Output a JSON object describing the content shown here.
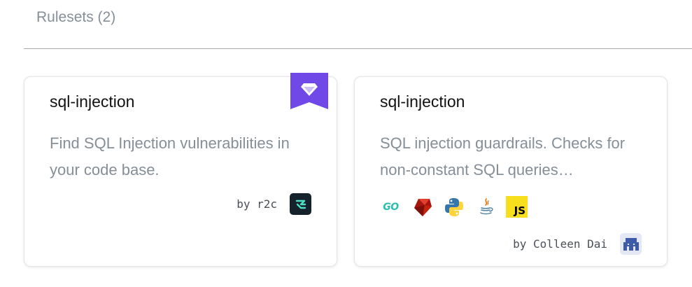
{
  "section": {
    "title": "Rulesets (2)"
  },
  "cards": [
    {
      "title": "sql-injection",
      "description": "Find SQL Injection vulnerabilities in your code base.",
      "author": "by r2c",
      "pro_badge": true,
      "languages": []
    },
    {
      "title": "sql-injection",
      "description": "SQL injection guardrails. Checks for non-constant SQL queries…",
      "author": "by Colleen Dai",
      "pro_badge": false,
      "languages": [
        "go-icon",
        "ruby-icon",
        "python-icon",
        "java-icon",
        "javascript-icon"
      ]
    }
  ],
  "language_labels": {
    "go": "GO",
    "javascript": "JS"
  },
  "colors": {
    "pro_ribbon": "#7048e8",
    "r2c_avatar": "#16222b",
    "r2c_mark": "#4de0c6",
    "muted_text": "#868e96"
  }
}
